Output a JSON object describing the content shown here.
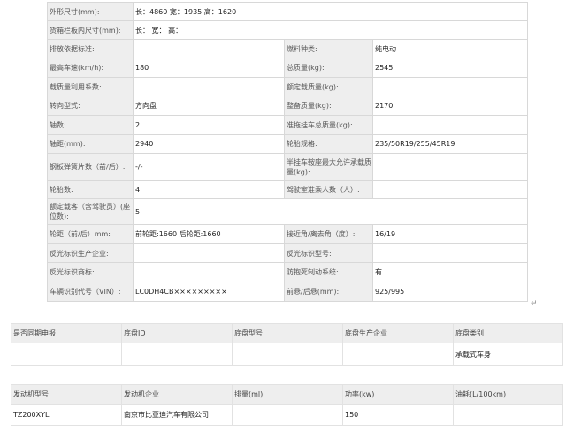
{
  "specs": [
    [
      {
        "k": "外形尺寸(mm):",
        "v": "长：4860 宽：1935 高：1620",
        "span": 3
      }
    ],
    [
      {
        "k": "货箱栏板内尺寸(mm):",
        "v": "长： 宽： 高：",
        "span": 3
      }
    ],
    [
      {
        "k": "排放依据标准:",
        "v": ""
      },
      {
        "k": "燃料种类:",
        "v": "纯电动"
      }
    ],
    [
      {
        "k": "最高车速(km/h):",
        "v": "180"
      },
      {
        "k": "总质量(kg):",
        "v": "2545"
      }
    ],
    [
      {
        "k": "载质量利用系数:",
        "v": ""
      },
      {
        "k": "额定载质量(kg):",
        "v": ""
      }
    ],
    [
      {
        "k": "转向型式:",
        "v": "方向盘"
      },
      {
        "k": "整备质量(kg):",
        "v": "2170"
      }
    ],
    [
      {
        "k": "轴数:",
        "v": "2"
      },
      {
        "k": "准拖挂车总质量(kg):",
        "v": ""
      }
    ],
    [
      {
        "k": "轴距(mm):",
        "v": "2940"
      },
      {
        "k": "轮胎规格:",
        "v": "235/50R19/255/45R19"
      }
    ],
    [
      {
        "k": "钢板弹簧片数（前/后）:",
        "v": "-/-"
      },
      {
        "k": "半挂车鞍座最大允许承载质量(kg):",
        "v": ""
      }
    ],
    [
      {
        "k": "轮胎数:",
        "v": "4"
      },
      {
        "k": "驾驶室准乘人数（人）:",
        "v": ""
      }
    ],
    [
      {
        "k": "额定载客（含驾驶员）(座位数):",
        "v": "5",
        "span": 3
      }
    ],
    [
      {
        "k": "轮距（前/后）mm:",
        "v": "前轮距:1660 后轮距:1660"
      },
      {
        "k": "接近角/离去角（度）:",
        "v": "16/19"
      }
    ],
    [
      {
        "k": "反光标识生产企业:",
        "v": ""
      },
      {
        "k": "反光标识型号:",
        "v": ""
      }
    ],
    [
      {
        "k": "反光标识商标:",
        "v": ""
      },
      {
        "k": "防抱死制动系统:",
        "v": "有"
      }
    ],
    [
      {
        "k": "车辆识别代号（VIN）:",
        "v": "LC0DH4CB×××××××××"
      },
      {
        "k": "前悬/后悬(mm):",
        "v": "925/995"
      }
    ]
  ],
  "return_mark": "↵",
  "chassis": {
    "headers": [
      "是否同期申报",
      "底盘ID",
      "底盘型号",
      "底盘生产企业",
      "底盘类别"
    ],
    "row": [
      "",
      "",
      "",
      "",
      "承载式车身"
    ]
  },
  "engine": {
    "headers": [
      "发动机型号",
      "发动机企业",
      "排量(ml)",
      "功率(kw)",
      "油耗(L/100km)"
    ],
    "row": [
      "TZ200XYL",
      "南京市比亚迪汽车有限公司",
      "",
      "150",
      ""
    ]
  }
}
